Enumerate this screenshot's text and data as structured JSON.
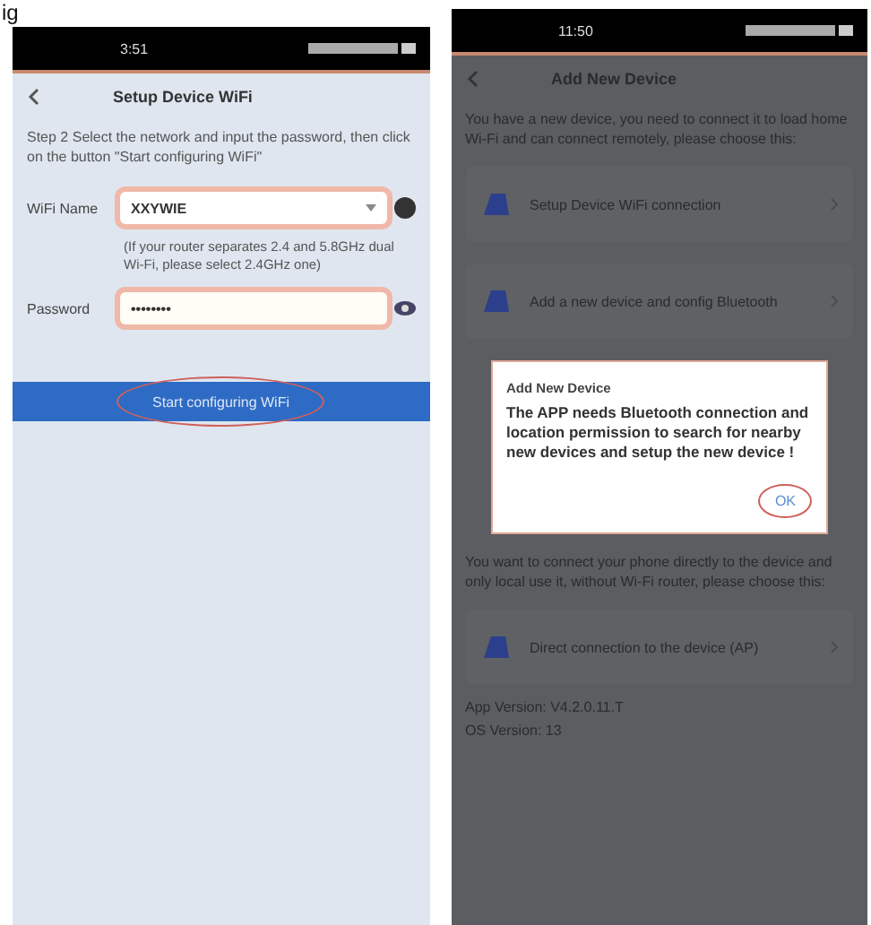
{
  "caption_fragment": "ig",
  "screens": [
    {
      "kind": "setup",
      "status_time": "3:51",
      "title": "Setup Device WiFi",
      "instructions": "Step 2 Select the network and input the password, then click on the button \"Start configuring WiFi\"",
      "wifi_field": {
        "label": "WiFi Name",
        "value": "XXYWIE",
        "circled": true
      },
      "hint": "(If your router separates 2.4 and 5.8GHz dual Wi-Fi, please select 2.4GHz one)",
      "password_field": {
        "label": "Password",
        "value": "••••••••",
        "circled": true
      },
      "button": {
        "label": "Start configuring WiFi",
        "circled": true
      }
    },
    {
      "kind": "add",
      "status_time": "11:50",
      "title": "Add New Device",
      "intro": "You have a new device, you need to connect it to load home Wi-Fi and can connect remotely, please choose this:",
      "options": [
        {
          "label": "Setup Device WiFi connection"
        },
        {
          "label": "Add a new device and config Bluetooth"
        }
      ],
      "dialog": {
        "title": "Add New Device",
        "message": "The APP needs Bluetooth connection and location permission to search for nearby new devices and setup the new device !",
        "button": "OK",
        "circled": true
      },
      "direct_intro": "You want to connect your phone directly to the device and only local use it, without Wi-Fi router, please choose this:",
      "direct_option": {
        "label": "Direct connection to the device (AP)"
      },
      "app_version": "App Version: V4.2.0.11.T",
      "os_version": "OS Version: 13"
    }
  ]
}
